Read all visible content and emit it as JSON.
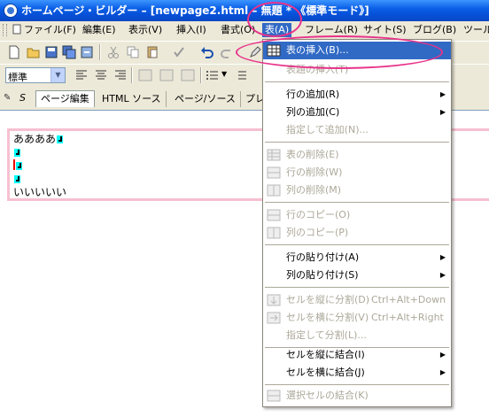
{
  "window": {
    "title": "ホームページ・ビルダー – [newpage2.html – 無題 * 《標準モード》]"
  },
  "menubar": {
    "items": [
      {
        "id": "file",
        "label": "ファイル(F)"
      },
      {
        "id": "edit",
        "label": "編集(E)"
      },
      {
        "id": "view",
        "label": "表示(V)"
      },
      {
        "id": "insert",
        "label": "挿入(I)"
      },
      {
        "id": "format",
        "label": "書式(O)"
      },
      {
        "id": "table",
        "label": "表(A)"
      },
      {
        "id": "frame",
        "label": "フレーム(R)"
      },
      {
        "id": "site",
        "label": "サイト(S)"
      },
      {
        "id": "blog",
        "label": "ブログ(B)"
      },
      {
        "id": "tools",
        "label": "ツール"
      }
    ]
  },
  "toolbar": {
    "style_combo_value": "標準"
  },
  "tabs": [
    {
      "label": "ページ編集"
    },
    {
      "label": "HTML ソース"
    },
    {
      "label": "ページ/ソース"
    },
    {
      "label": "プレ"
    }
  ],
  "editor": {
    "lines": [
      "ああああ",
      "",
      "",
      "",
      "いいいいい"
    ]
  },
  "table_menu": {
    "items": [
      {
        "label": "表の挿入(B)...",
        "shortcut": "",
        "icon": "table-insert-icon"
      },
      {
        "label": "表題の挿入(T)",
        "shortcut": ""
      },
      {
        "label": "行の追加(R)",
        "submenu": true
      },
      {
        "label": "列の追加(C)",
        "submenu": true
      },
      {
        "label": "指定して追加(N)..."
      },
      {
        "label": "表の削除(E)",
        "icon": "table-delete-icon"
      },
      {
        "label": "行の削除(W)",
        "icon": "row-delete-icon"
      },
      {
        "label": "列の削除(M)",
        "icon": "column-delete-icon"
      },
      {
        "label": "行のコピー(O)",
        "icon": "row-copy-icon"
      },
      {
        "label": "列のコピー(P)",
        "icon": "column-copy-icon"
      },
      {
        "label": "行の貼り付け(A)",
        "submenu": true
      },
      {
        "label": "列の貼り付け(S)",
        "submenu": true
      },
      {
        "label": "セルを縦に分割(D)",
        "shortcut": "Ctrl+Alt+Down",
        "icon": "split-vertical-icon"
      },
      {
        "label": "セルを横に分割(V)",
        "shortcut": "Ctrl+Alt+Right",
        "icon": "split-horizontal-icon"
      },
      {
        "label": "指定して分割(L)..."
      },
      {
        "label": "セルを縦に結合(I)",
        "submenu": true
      },
      {
        "label": "セルを横に結合(J)",
        "submenu": true
      },
      {
        "label": "選択セルの結合(K)",
        "icon": "merge-cells-icon"
      }
    ]
  },
  "colors": {
    "highlight": "#316ac5",
    "annotation": "#e8338a",
    "titlebar": "#0a5fe6"
  }
}
